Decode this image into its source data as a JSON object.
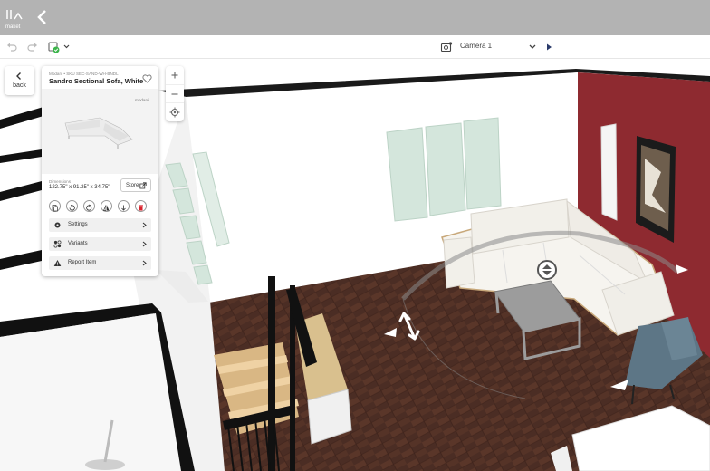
{
  "app": {
    "logo_text": "maket"
  },
  "toolbar": {
    "camera_label": "Camera 1"
  },
  "back_tile": {
    "label": "back"
  },
  "product": {
    "breadcrumb": "Modani • SKU SEC-SAND-WH-BNDL",
    "title": "Sandro Sectional Sofa, White",
    "brand": "modani",
    "dimensions_label": "Dimensions",
    "dimensions_value": "122.75\" x 91.25\" x 34.75\"",
    "store_label": "Store",
    "menu": [
      {
        "label": "Settings",
        "icon": "gear-icon"
      },
      {
        "label": "Variants",
        "icon": "variants-icon"
      },
      {
        "label": "Report Item",
        "icon": "warning-icon"
      }
    ]
  },
  "colors": {
    "appbar": "#b3b3b3",
    "accent_wall": "#8e2a30",
    "floor": "#4a2c22",
    "delete": "#d9232d"
  }
}
